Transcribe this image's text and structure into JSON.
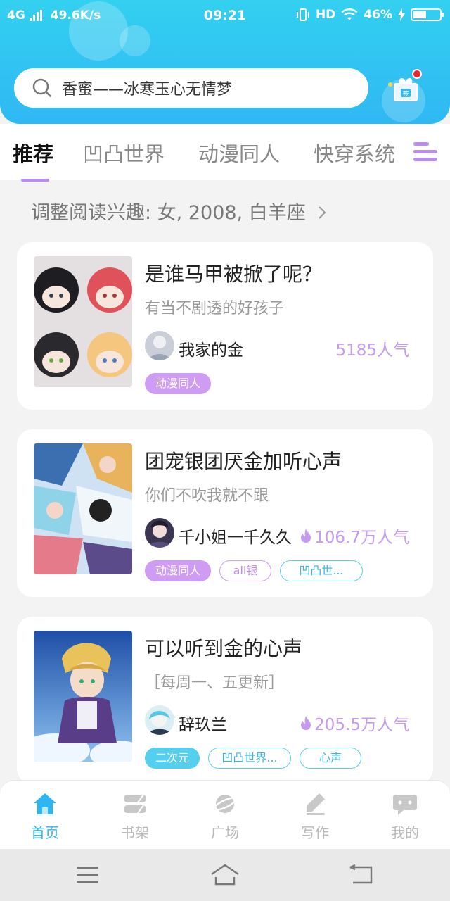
{
  "status_bar": {
    "network": "4G",
    "speed": "49.6K/s",
    "time": "09:21",
    "hd": "HD",
    "battery": "46%"
  },
  "search": {
    "placeholder": "香蜜——冰寒玉心无情梦"
  },
  "tabs": [
    {
      "label": "推荐",
      "active": true
    },
    {
      "label": "凹凸世界",
      "active": false
    },
    {
      "label": "动漫同人",
      "active": false
    },
    {
      "label": "快穿系统",
      "active": false
    }
  ],
  "interest": {
    "label": "调整阅读兴趣: 女, 2008, 白羊座"
  },
  "books": [
    {
      "title": "是谁马甲被掀了呢？",
      "desc": "有当不剧透的好孩子",
      "author": "我家的金",
      "popularity": "5185人气",
      "hot": false,
      "tags": [
        "动漫同人"
      ]
    },
    {
      "title": "团宠银团厌金加听心声",
      "desc": "你们不吹我就不跟",
      "author": "千小姐一千久久",
      "popularity": "106.7万人气",
      "hot": true,
      "tags": [
        "动漫同人",
        "all银",
        "凹凸世..."
      ]
    },
    {
      "title": "可以听到金的心声",
      "desc": "［每周一、五更新］",
      "author": "辞玖兰",
      "popularity": "205.5万人气",
      "hot": true,
      "tags": [
        "二次元",
        "凹凸世界...",
        "心声"
      ]
    }
  ],
  "bottom_nav": [
    {
      "label": "首页",
      "icon": "home-icon",
      "active": true
    },
    {
      "label": "书架",
      "icon": "bookshelf-icon",
      "active": false
    },
    {
      "label": "广场",
      "icon": "planet-icon",
      "active": false
    },
    {
      "label": "写作",
      "icon": "pen-icon",
      "active": false
    },
    {
      "label": "我的",
      "icon": "chat-bubble-icon",
      "active": false
    }
  ],
  "colors": {
    "header": "#33d0f0",
    "accent_purple": "#cf9cf4",
    "accent_blue": "#2eb6f2"
  }
}
